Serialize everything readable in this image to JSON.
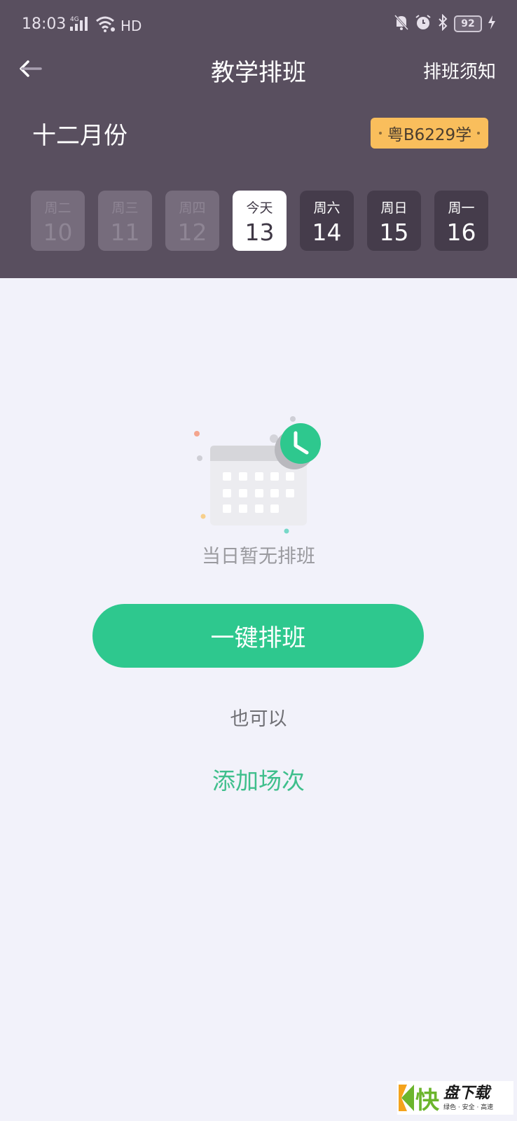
{
  "status_bar": {
    "time": "18:03",
    "network": "4G",
    "hd_label": "HD",
    "battery_level": "92",
    "icons": [
      "signal-icon",
      "wifi-icon",
      "hd-icon",
      "mute-icon",
      "alarm-icon",
      "bluetooth-icon",
      "battery-icon",
      "charging-icon"
    ]
  },
  "nav": {
    "title": "教学排班",
    "right_link": "排班须知",
    "back_icon": "arrow-left-icon"
  },
  "month_label": "十二月份",
  "plate_number": "粤B6229学",
  "days": [
    {
      "weekday": "周二",
      "date": "10",
      "state": "past"
    },
    {
      "weekday": "周三",
      "date": "11",
      "state": "past"
    },
    {
      "weekday": "周四",
      "date": "12",
      "state": "past"
    },
    {
      "weekday": "今天",
      "date": "13",
      "state": "today"
    },
    {
      "weekday": "周六",
      "date": "14",
      "state": "future"
    },
    {
      "weekday": "周日",
      "date": "15",
      "state": "future"
    },
    {
      "weekday": "周一",
      "date": "16",
      "state": "future"
    }
  ],
  "empty_state": {
    "icon": "calendar-clock-icon",
    "text": "当日暂无排班"
  },
  "primary_button": "一键排班",
  "or_text": "也可以",
  "add_session_link": "添加场次",
  "watermark": {
    "kuai": "快",
    "name": "盘下载",
    "slogan": "绿色 · 安全 · 高速"
  },
  "colors": {
    "header_bg": "#594f5f",
    "accent_green": "#2ec88e",
    "plate_yellow": "#f9be5c",
    "page_bg": "#f2f2fa"
  }
}
